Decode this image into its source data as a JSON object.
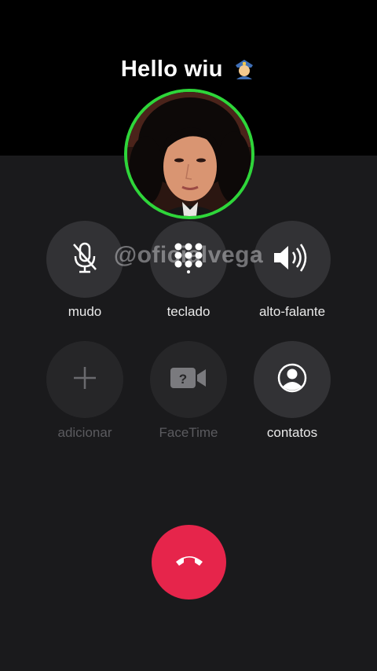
{
  "caller": {
    "name": "Hello wiu",
    "emoji_icon": "police-officer-emoji"
  },
  "avatar": {
    "icon": "contact-photo"
  },
  "watermark": "@oficialvega",
  "buttons": [
    {
      "id": "mute",
      "label": "mudo",
      "icon": "mic-slash-icon",
      "enabled": true
    },
    {
      "id": "keypad",
      "label": "teclado",
      "icon": "keypad-icon",
      "enabled": true
    },
    {
      "id": "speaker",
      "label": "alto-falante",
      "icon": "speaker-icon",
      "enabled": true
    },
    {
      "id": "add",
      "label": "adicionar",
      "icon": "plus-icon",
      "enabled": false
    },
    {
      "id": "facetime",
      "label": "FaceTime",
      "icon": "facetime-icon",
      "enabled": false
    },
    {
      "id": "contacts",
      "label": "contatos",
      "icon": "person-circle-icon",
      "enabled": true
    }
  ],
  "end_call": {
    "icon": "phone-hangup-icon"
  },
  "colors": {
    "accent_ring": "#2ed63a",
    "end_call": "#e6254b"
  }
}
